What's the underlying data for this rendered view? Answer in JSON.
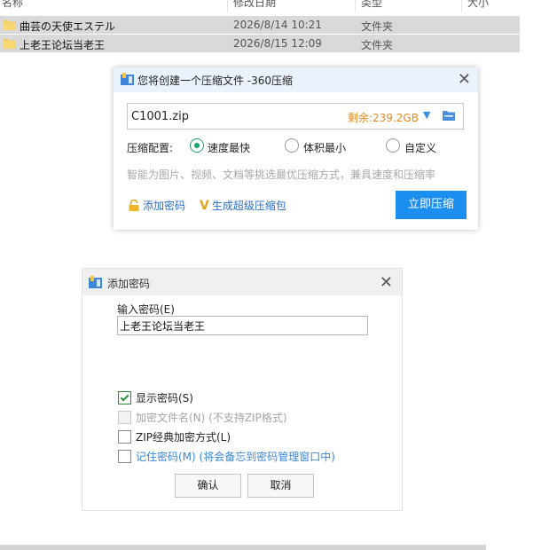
{
  "explorer": {
    "columns": [
      "名称",
      "修改日期",
      "类型",
      "大小"
    ],
    "rows": [
      {
        "name": "曲芸の天使エステル",
        "date": "2026/8/14 10:21",
        "type": "文件夹"
      },
      {
        "name": "上老王论坛当老王",
        "date": "2026/8/15 12:09",
        "type": "文件夹"
      }
    ]
  },
  "zip_dialog": {
    "title": "您将创建一个压缩文件 -360压缩",
    "close_glyph": "✕",
    "filename": "C1001.zip",
    "free_space": "剩余:239.2GB",
    "dropdown_glyph": "▼",
    "config_label": "压缩配置:",
    "options": [
      {
        "label": "速度最快",
        "selected": true
      },
      {
        "label": "体积最小",
        "selected": false
      },
      {
        "label": "自定义",
        "selected": false
      }
    ],
    "hint": "智能为图片、视频、文档等挑选最优压缩方式，兼具速度和压缩率",
    "add_password_link": "添加密码",
    "super_link_glyph": "V",
    "super_link": "生成超级压缩包",
    "compress_button": "立即压缩"
  },
  "password_dialog": {
    "title": "添加密码",
    "close_glyph": "✕",
    "input_label": "输入密码(E)",
    "input_value": "上老王论坛当老王",
    "checkboxes": [
      {
        "label": "显示密码(S)",
        "checked": true,
        "disabled": false
      },
      {
        "label": "加密文件名(N) (不支持ZIP格式)",
        "checked": false,
        "disabled": true
      },
      {
        "label": "ZIP经典加密方式(L)",
        "checked": false,
        "disabled": false
      },
      {
        "label": "记住密码(M) (将会备忘到密码管理窗口中)",
        "checked": false,
        "disabled": false
      }
    ],
    "ok_button": "确认",
    "cancel_button": "取消"
  },
  "colors": {
    "accent_blue": "#1a8ff0",
    "free_space_orange": "#e8891c",
    "radio_green": "#1aa36a",
    "row_selected_gray": "#d9d9d9"
  }
}
